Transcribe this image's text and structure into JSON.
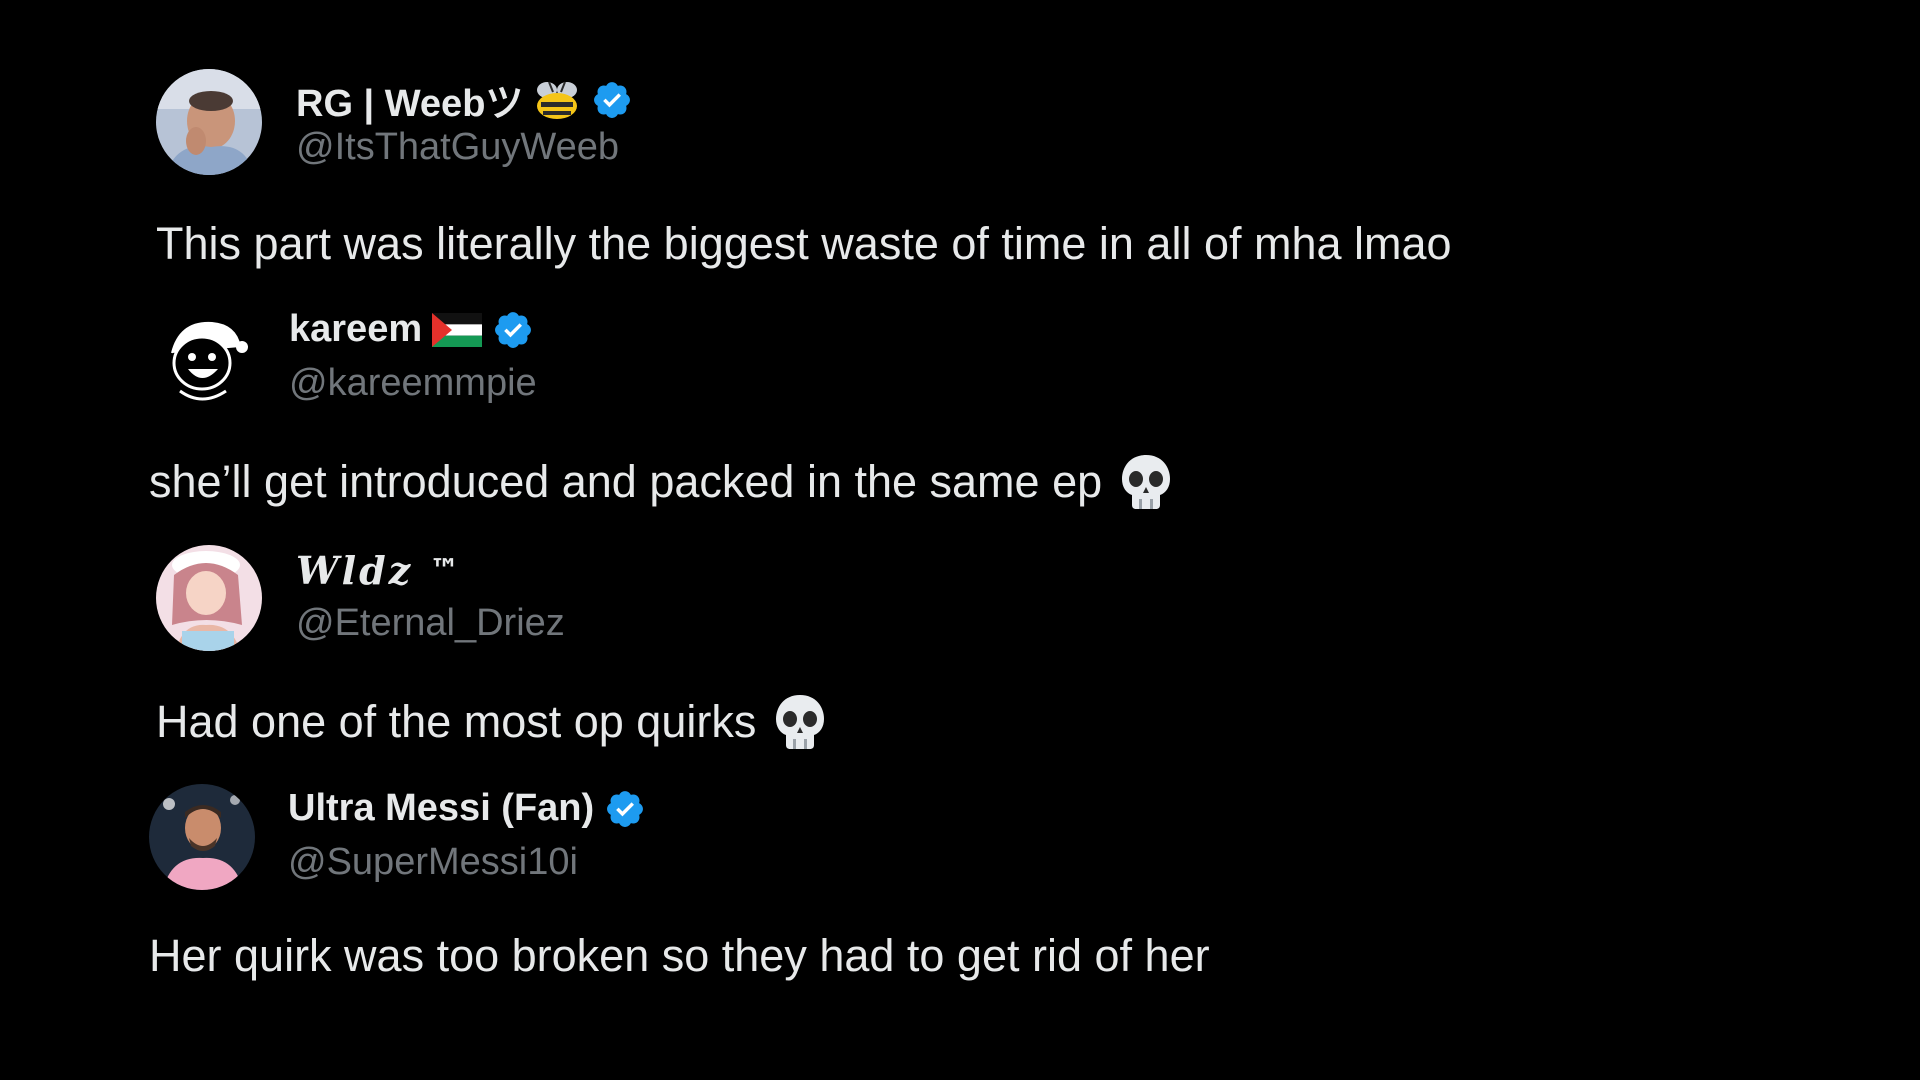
{
  "tweets": [
    {
      "display_name": "RG | Weebツ",
      "handle": "@ItsThatGuyWeeb",
      "text": "This part was literally the biggest waste of time in all of mha lmao",
      "name_icons": [
        "bee-emoji",
        "verified-badge-icon"
      ],
      "verified": true
    },
    {
      "display_name": "kareem",
      "handle": "@kareemmpie",
      "text": "she’ll get introduced and packed in the same ep",
      "name_icons": [
        "palestine-flag-emoji",
        "verified-badge-icon"
      ],
      "text_icons": [
        "skull-emoji"
      ],
      "verified": true
    },
    {
      "display_name": "𝑾𝒍𝒅𝒛",
      "name_suffix": "™",
      "handle": "@Eternal_Driez",
      "text": "Had one of the most op quirks",
      "text_icons": [
        "skull-emoji"
      ],
      "verified": false
    },
    {
      "display_name": "Ultra Messi (Fan)",
      "handle": "@SuperMessi10i",
      "text": "Her quirk was too broken so they had to get rid of her",
      "name_icons": [
        "verified-badge-icon"
      ],
      "verified": true
    }
  ],
  "colors": {
    "background": "#000000",
    "primary_text": "#e7e9ea",
    "secondary_text": "#71767b",
    "verified_blue": "#1d9bf0"
  }
}
